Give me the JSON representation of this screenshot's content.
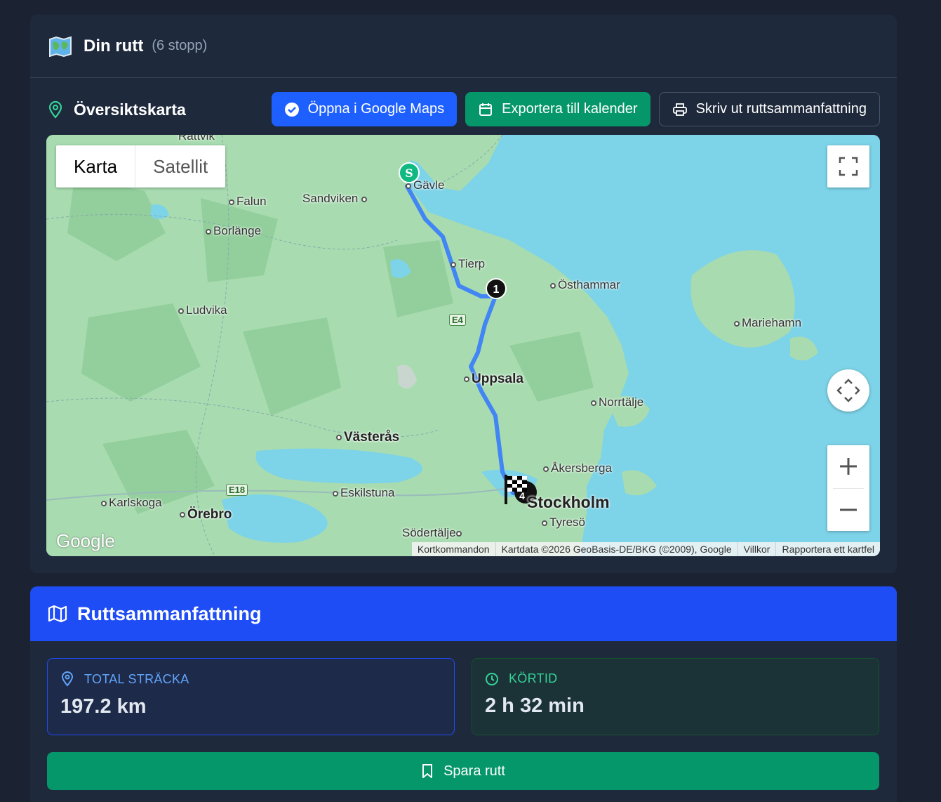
{
  "header": {
    "title": "Din rutt",
    "subtitle": "(6 stopp)"
  },
  "overview": {
    "title": "Översiktskarta",
    "buttons": {
      "google_maps": "Öppna i Google Maps",
      "calendar": "Exportera till kalender",
      "print": "Skriv ut ruttsammanfattning"
    }
  },
  "map": {
    "type_map": "Karta",
    "type_satellite": "Satellit",
    "logo": "Google",
    "attribution": {
      "shortcuts": "Kortkommandon",
      "data": "Kartdata ©2026 GeoBasis-DE/BKG (©2009), Google",
      "terms": "Villkor",
      "report": "Rapportera ett kartfel"
    },
    "places": {
      "rattvik": "Rättvik",
      "gavle": "Gävle",
      "falun": "Falun",
      "sandviken": "Sandviken",
      "borlange": "Borlänge",
      "tierp": "Tierp",
      "osthammar": "Östhammar",
      "ludvika": "Ludvika",
      "mariehamn": "Mariehamn",
      "uppsala": "Uppsala",
      "norrtalje": "Norrtälje",
      "vasteras": "Västerås",
      "akersberga": "Åkersberga",
      "karlskoga": "Karlskoga",
      "eskilstuna": "Eskilstuna",
      "orebro": "Örebro",
      "stockholm": "Stockholm",
      "tyreso": "Tyresö",
      "sodertalje": "Södertälje"
    },
    "roads": {
      "e4": "E4",
      "e18": "E18"
    },
    "markers": {
      "start": "S",
      "stop1": "1",
      "end": "4"
    },
    "colors": {
      "route": "#4285f4",
      "land": "#a8dcb0",
      "water": "#7dd3e8"
    }
  },
  "summary": {
    "title": "Ruttsammanfattning",
    "distance_label": "TOTAL STRÄCKA",
    "distance_value": "197.2 km",
    "time_label": "KÖRTID",
    "time_value": "2 h 32 min",
    "save_label": "Spara rutt"
  }
}
